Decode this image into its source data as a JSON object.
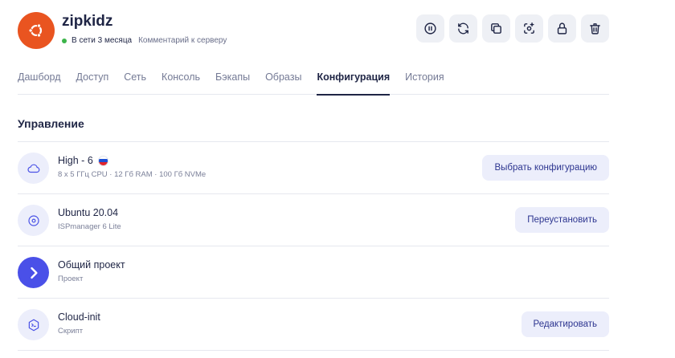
{
  "server": {
    "name": "zipkidz",
    "status": "В сети 3 месяца",
    "comment_link": "Комментарий к серверу",
    "avatar_color": "#e95420",
    "status_color": "#3cb44a"
  },
  "actions": [
    {
      "icon": "pause-icon"
    },
    {
      "icon": "refresh-icon"
    },
    {
      "icon": "copy-icon"
    },
    {
      "icon": "screenshot-icon"
    },
    {
      "icon": "lock-icon"
    },
    {
      "icon": "trash-icon"
    }
  ],
  "tabs": [
    {
      "label": "Дашборд"
    },
    {
      "label": "Доступ"
    },
    {
      "label": "Сеть"
    },
    {
      "label": "Консоль"
    },
    {
      "label": "Бэкапы"
    },
    {
      "label": "Образы"
    },
    {
      "label": "Конфигурация",
      "active": true
    },
    {
      "label": "История"
    }
  ],
  "section": {
    "title": "Управление"
  },
  "rows": [
    {
      "icon": "cloud-icon",
      "title": "High - 6",
      "flag": "ru",
      "subtitle": "8 x 5 ГГц CPU · 12 Гб RAM · 100 Гб NVMe",
      "button": "Выбрать конфигурацию"
    },
    {
      "icon": "disc-icon",
      "title": "Ubuntu 20.04",
      "subtitle": "ISPmanager 6 Lite",
      "button": "Переустановить"
    },
    {
      "icon": "project-icon",
      "title": "Общий проект",
      "subtitle": "Проект"
    },
    {
      "icon": "script-icon",
      "title": "Cloud-init",
      "subtitle": "Скрипт",
      "button": "Редактировать"
    }
  ],
  "colors": {
    "accent": "#4a50e8",
    "button_bg": "#eceefb",
    "text": "#1f2545"
  }
}
